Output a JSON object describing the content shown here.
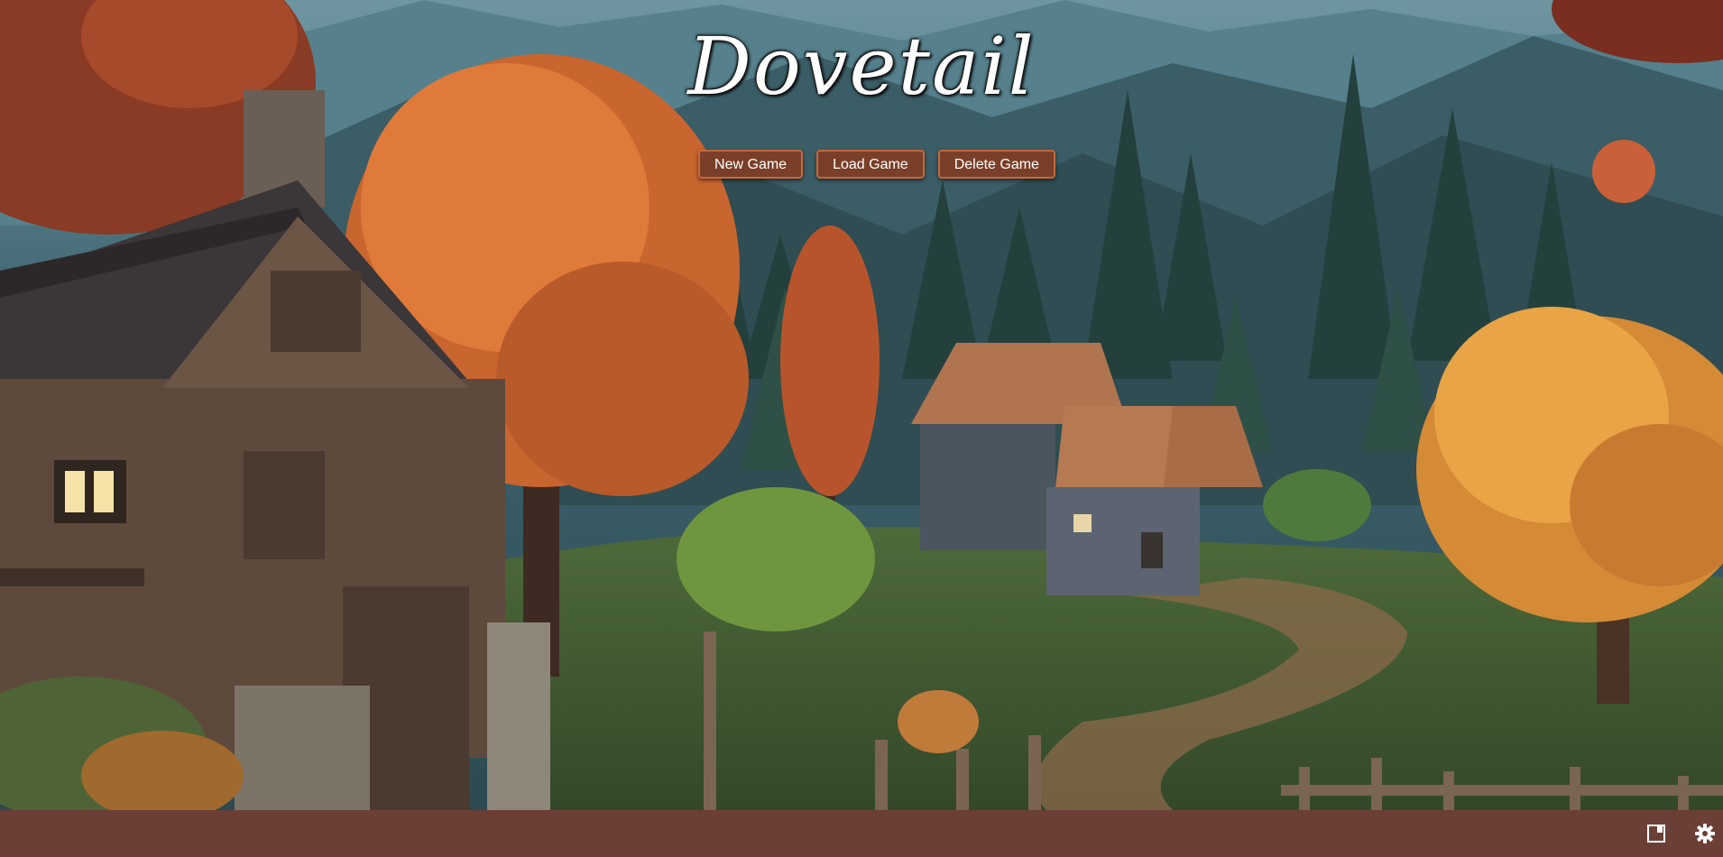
{
  "game": {
    "title": "Dovetail"
  },
  "menu": {
    "new_game": "New Game",
    "load_game": "Load Game",
    "delete_game": "Delete Game"
  },
  "bottom_bar": {
    "icons": [
      "save-icon",
      "settings-gear-icon"
    ]
  },
  "colors": {
    "button_bg": "#7a3f28",
    "button_border": "#c4693f",
    "bottom_bar": "#6b3f36"
  }
}
